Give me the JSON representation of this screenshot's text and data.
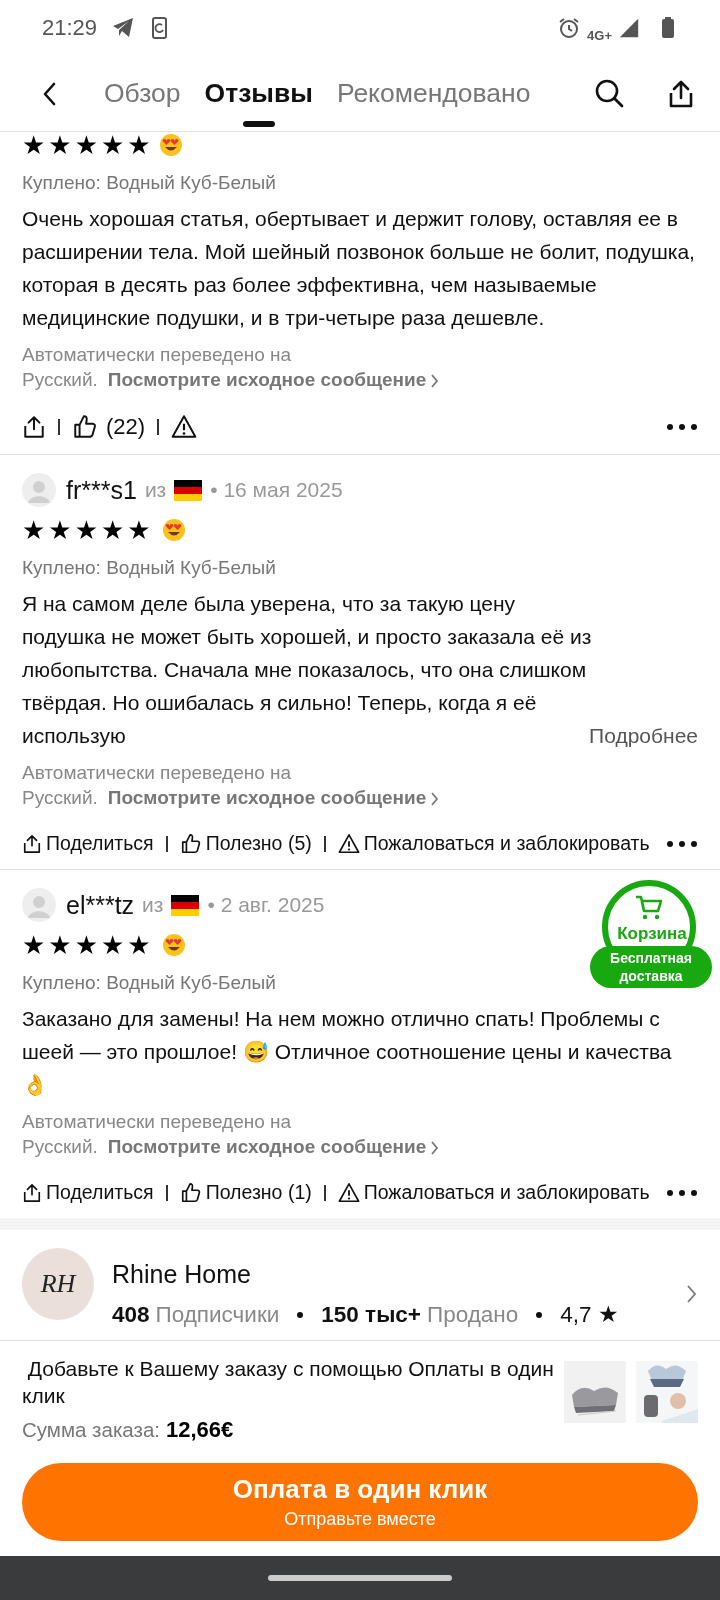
{
  "status_bar": {
    "time": "21:29",
    "network": "4G+"
  },
  "nav": {
    "tabs": [
      {
        "label": "Обзор",
        "selected": false
      },
      {
        "label": "Отзывы",
        "selected": true
      },
      {
        "label": "Рекомендовано",
        "selected": false
      }
    ]
  },
  "reviews": [
    {
      "stars": 5,
      "purchased": "Куплено: Водный Куб-Белый",
      "text": "Очень хорошая статья, обертывает и держит голову, оставляя ее в расширении тела. Мой шейный позвонок больше не болит, подушка, которая в десять раз более эффективна, чем называемые медицинские подушки, и в три-четыре раза дешевле.",
      "translation": "Автоматически переведено на Русский.",
      "original_link": "Посмотрите исходное сообщение",
      "helpful": "(22)"
    },
    {
      "user": "fr***s1",
      "from": "из",
      "date": "• 16 мая 2025",
      "stars": 5,
      "purchased": "Куплено: Водный Куб-Белый",
      "text": "Я на самом деле была уверена, что за такую цену подушка не может быть хорошей, и просто заказала её из любопытства. Сначала мне показалось, что она слишком твёрдая. Но ошибалась я сильно! Теперь, когда я её использую",
      "more": "Подробнее",
      "translation": "Автоматически переведено на Русский.",
      "original_link": "Посмотрите исходное сообщение",
      "share": "Поделиться",
      "helpful": "Полезно (5)",
      "report": "Пожаловаться и заблокировать"
    },
    {
      "user": "el***tz",
      "from": "из",
      "date": "• 2 авг. 2025",
      "stars": 5,
      "purchased": "Куплено: Водный Куб-Белый",
      "text": "Заказано для замены! На нем можно отлично спать! Проблемы с шеей — это прошлое! 😅 Отличное соотношение цены и качества 👌",
      "translation": "Автоматически переведено на Русский.",
      "original_link": "Посмотрите исходное сообщение",
      "share": "Поделиться",
      "helpful": "Полезно (1)",
      "report": "Пожаловаться и заблокировать"
    }
  ],
  "cart_badge": {
    "label": "Корзина",
    "promo": "Бесплатная доставка"
  },
  "store": {
    "logo_text": "RH",
    "name": "Rhine Home",
    "followers": "408",
    "followers_label": "Подписчики",
    "sold": "150 тыс+",
    "sold_label": "Продано",
    "rating": "4,7",
    "rating_star": "★"
  },
  "order": {
    "message": " Добавьте к Вашему заказу с помощью Оплаты в один клик",
    "total_label": "Сумма заказа:",
    "total": "12,66€",
    "button": "Оплата в один клик",
    "button_sub": "Отправьте вместе"
  }
}
